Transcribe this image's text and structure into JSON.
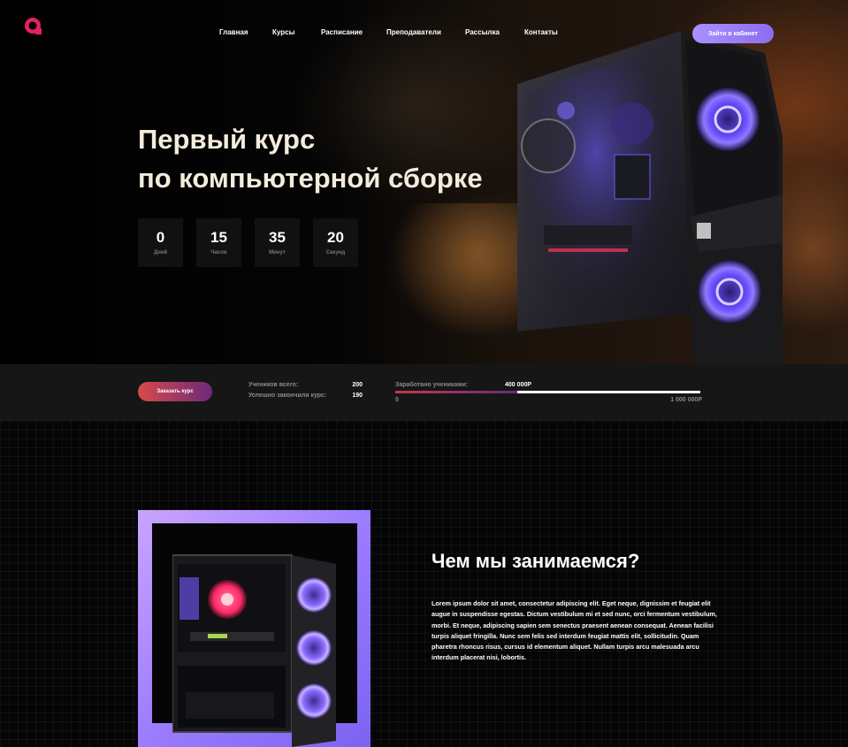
{
  "nav": {
    "items": [
      "Главная",
      "Курсы",
      "Расписание",
      "Преподаватели",
      "Рассылка",
      "Контакты"
    ],
    "cabinet_button": "Зайти в кабинет"
  },
  "hero": {
    "title_line1": "Первый курс",
    "title_line2": "по компьютерной сборке",
    "timer": [
      {
        "value": "0",
        "label": "Дней"
      },
      {
        "value": "15",
        "label": "Часов"
      },
      {
        "value": "35",
        "label": "Минут"
      },
      {
        "value": "20",
        "label": "Секунд"
      }
    ]
  },
  "stats": {
    "order_button": "Заказать курс",
    "students_total_label": "Учеников всего:",
    "students_total_value": "200",
    "graduated_label": "Успешно закончили курс:",
    "graduated_value": "190",
    "earned_label": "Заработано учениками:",
    "earned_value": "400 000Р",
    "progress_min": "0",
    "progress_max": "1 000 000Р",
    "progress_fraction": 0.4
  },
  "about": {
    "title": "Чем мы занимаемся?",
    "text": "Lorem ipsum dolor sit amet, consectetur adipiscing elit. Eget neque, dignissim et feugiat elit augue in suspendisse egestas. Dictum vestibulum mi et sed nunc, orci fermentum vestibulum, morbi. Et neque, adipiscing sapien sem senectus praesent aenean consequat. Aenean facilisi turpis aliquet fringilla. Nunc sem felis sed interdum feugiat mattis elit, sollicitudin. Quam pharetra rhoncus risus, cursus id elementum aliquet. Nullam turpis arcu malesuada arcu interdum placerat nisi, lobortis."
  },
  "colors": {
    "accent_purple": "#a991ff",
    "accent_red": "#d84a4a",
    "logo_red": "#e0245e"
  }
}
